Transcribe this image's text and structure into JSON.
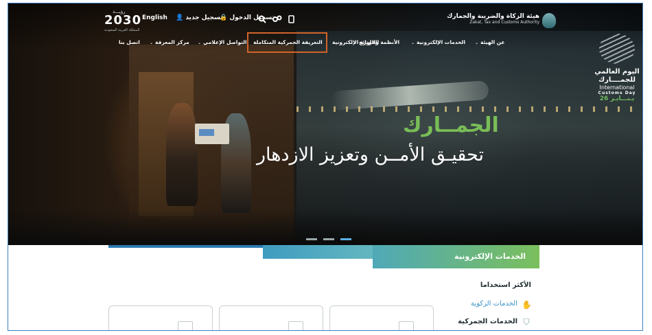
{
  "header": {
    "vision_small": "رؤيـــة",
    "vision_big": "2030",
    "vision_tiny": "المملكة العربية السعودية",
    "lang_label": "English",
    "register_label": "تسجيل جديد",
    "login_label": "تسجيل الدخول",
    "logo_ar": "هيئة الزكاة والضريبة والجمارك",
    "logo_en": "Zakat, Tax and Customs Authority"
  },
  "nav": {
    "items": [
      {
        "label": "عن الهيئة",
        "dropdown": true
      },
      {
        "label": "الخدمات الإلكترونية",
        "dropdown": true
      },
      {
        "label": "الأنظمة واللوائح",
        "dropdown": true
      },
      {
        "label": "الفوترة الإلكترونية",
        "dropdown": false
      },
      {
        "label": "التعريفة الجمركية المتكاملة",
        "dropdown": false
      },
      {
        "label": "التواصل الإعلامي",
        "dropdown": true
      },
      {
        "label": "مركز المعرفة",
        "dropdown": true
      },
      {
        "label": "اتصل بنا",
        "dropdown": false
      }
    ],
    "highlight_color": "#d2642a"
  },
  "side_banner": {
    "ar_line1": "اليوم العالمي",
    "ar_line2": "للجمــــارك",
    "en_line1": "International",
    "en_line2": "Customs Day",
    "date": "26 يـنـــايـر"
  },
  "hero": {
    "title": "الجمــارك",
    "subtitle": "تحقيـق الأمــن وتعزيز الازدهار",
    "slides": 3,
    "active_slide": 3
  },
  "services": {
    "tab_label": "الخدمات الإلكترونية",
    "most_used_label": "الأكثر استخداما",
    "items": [
      {
        "label": "الخدمات الزكوية",
        "icon": "hand-coin-icon"
      },
      {
        "label": "الخدمات الجمركية",
        "icon": "shield-icon"
      }
    ]
  },
  "colors": {
    "green": "#79bd57",
    "blue": "#2b79b1",
    "teal": "#4fa9b8"
  }
}
